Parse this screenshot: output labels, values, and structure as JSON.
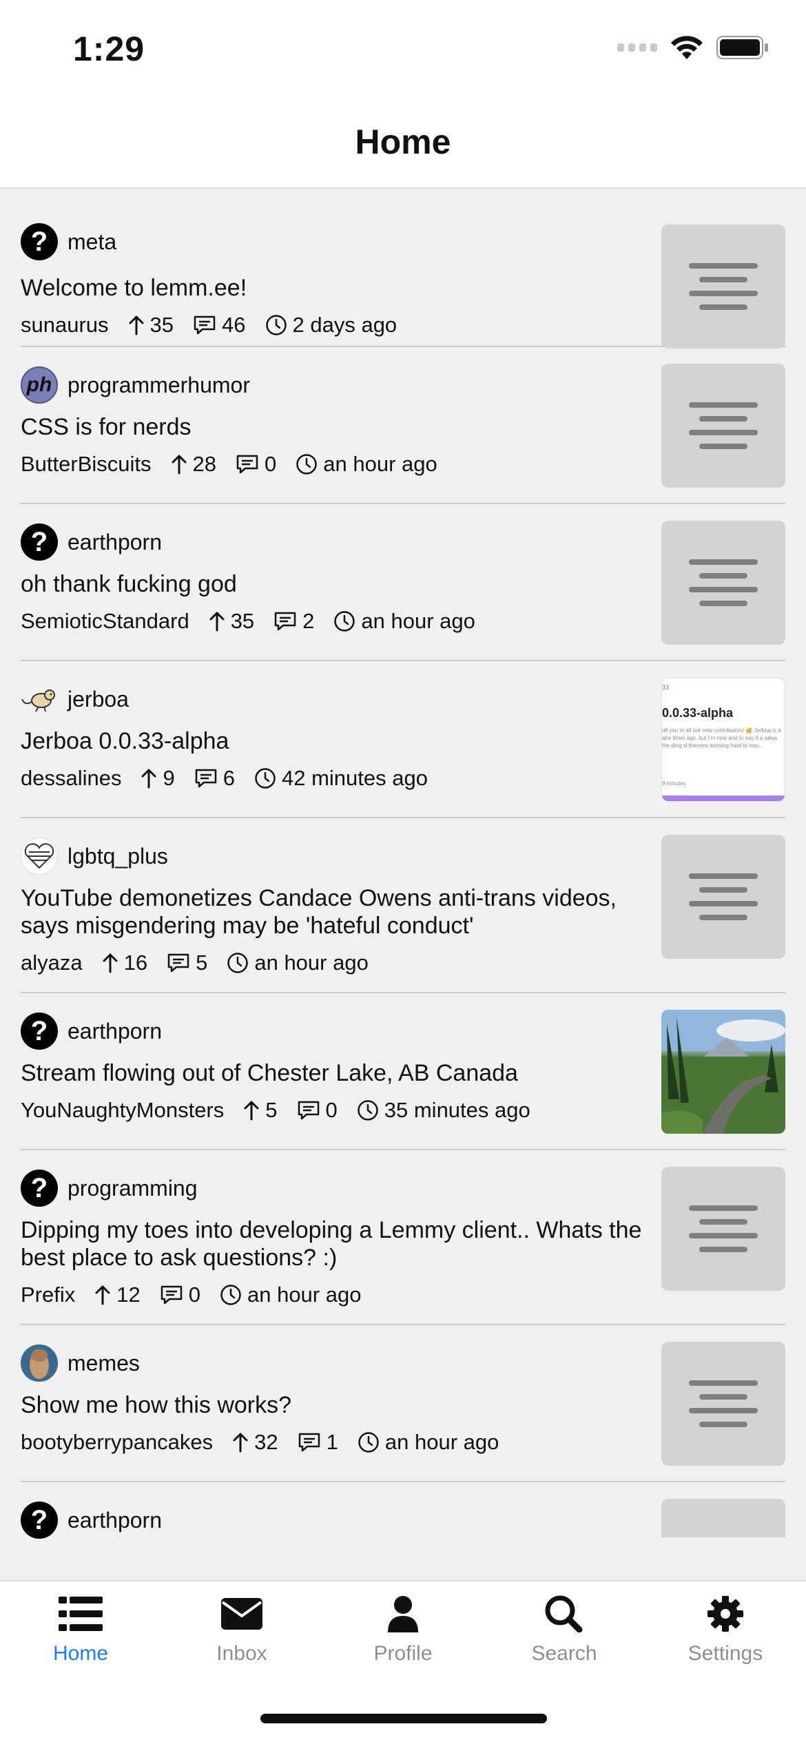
{
  "status_bar": {
    "time": "1:29"
  },
  "header": {
    "title": "Home"
  },
  "posts": [
    {
      "community": "meta",
      "avatar": "question-icon",
      "title": "Welcome to lemm.ee!",
      "author": "sunaurus",
      "score": "35",
      "comments": "46",
      "time": "2 days ago",
      "thumbnail": "text-placeholder"
    },
    {
      "community": "programmerhumor",
      "avatar": "ph",
      "title": "CSS is for nerds",
      "author": "ButterBiscuits",
      "score": "28",
      "comments": "0",
      "time": "an hour ago",
      "thumbnail": "text-placeholder"
    },
    {
      "community": "earthporn",
      "avatar": "question-icon",
      "title": "oh thank fucking god",
      "author": "SemioticStandard",
      "score": "35",
      "comments": "2",
      "time": "an hour ago",
      "thumbnail": "text-placeholder"
    },
    {
      "community": "jerboa",
      "avatar": "jerboa-animal",
      "title": "Jerboa 0.0.33-alpha",
      "author": "dessalines",
      "score": "9",
      "comments": "6",
      "time": "42 minutes ago",
      "thumbnail": "jerboa-preview",
      "thumb_text": {
        "version": "0.0.33-alpha",
        "tiny": "33",
        "body": "ull you to all our new contributors! 🥳 Jerboa is a ahe time) ago. but I'm now and to say if a salsa the ding sl thereins worsing hard to insu..",
        "foot": "9 minutes"
      }
    },
    {
      "community": "lgbtq_plus",
      "avatar": "pride-heart",
      "title": "YouTube demonetizes Candace Owens anti-trans videos, says misgendering may be 'hateful conduct'",
      "author": "alyaza",
      "score": "16",
      "comments": "5",
      "time": "an hour ago",
      "thumbnail": "text-placeholder"
    },
    {
      "community": "earthporn",
      "avatar": "question-icon",
      "title": "Stream flowing out of Chester Lake, AB Canada",
      "author": "YouNaughtyMonsters",
      "score": "5",
      "comments": "0",
      "time": "35 minutes ago",
      "thumbnail": "lake-photo"
    },
    {
      "community": "programming",
      "avatar": "question-icon",
      "title": "Dipping my toes into developing a Lemmy client.. Whats the best place to ask questions? :)",
      "author": "Prefix",
      "score": "12",
      "comments": "0",
      "time": "an hour ago",
      "thumbnail": "text-placeholder"
    },
    {
      "community": "memes",
      "avatar": "meme-face",
      "title": "Show me how this works?",
      "author": "bootyberrypancakes",
      "score": "32",
      "comments": "1",
      "time": "an hour ago",
      "thumbnail": "text-placeholder"
    },
    {
      "community": "earthporn",
      "avatar": "question-icon",
      "title": "",
      "author": "",
      "score": "",
      "comments": "",
      "time": "",
      "thumbnail": "text-placeholder"
    }
  ],
  "tabbar": {
    "tabs": [
      {
        "label": "Home",
        "icon": "list-icon",
        "active": true
      },
      {
        "label": "Inbox",
        "icon": "envelope-icon",
        "active": false
      },
      {
        "label": "Profile",
        "icon": "person-icon",
        "active": false
      },
      {
        "label": "Search",
        "icon": "search-icon",
        "active": false
      },
      {
        "label": "Settings",
        "icon": "gear-icon",
        "active": false
      }
    ]
  },
  "colors": {
    "accent": "#1b7df0",
    "inactive_tab": "#8e8e8e",
    "background": "#f0f0f0",
    "thumb_placeholder": "#d3d3d3"
  }
}
